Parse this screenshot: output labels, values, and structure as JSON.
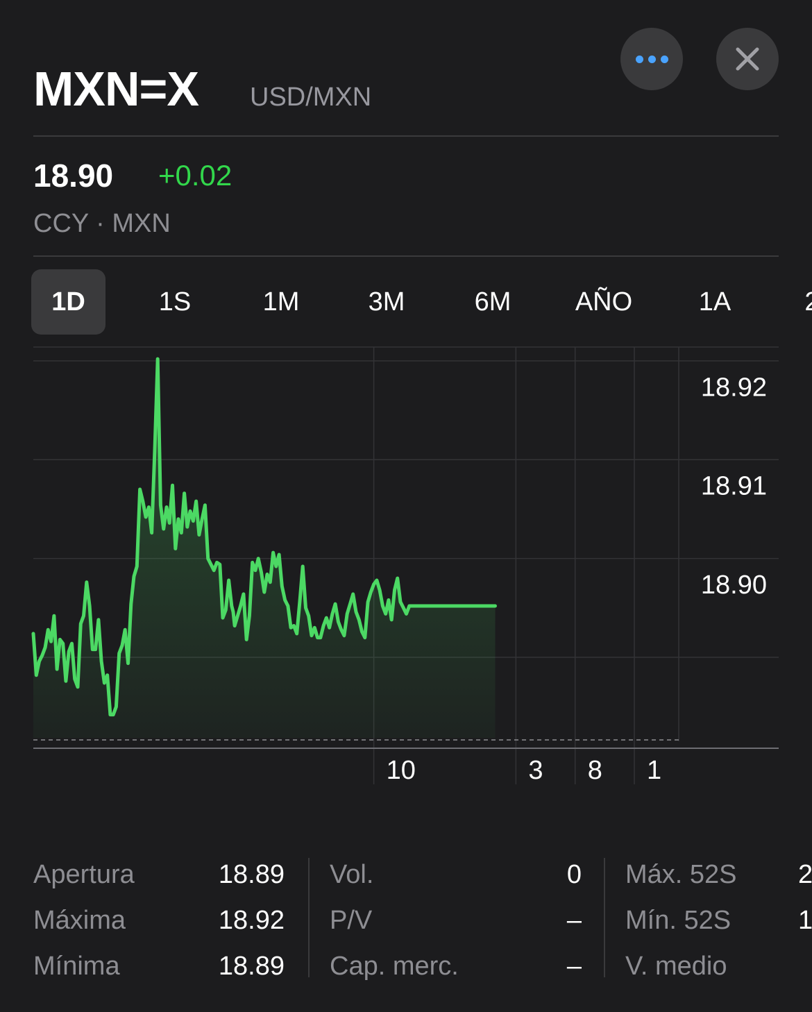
{
  "header": {
    "symbol": "MXN=X",
    "name": "USD/MXN",
    "more_icon": "ellipsis-icon",
    "close_icon": "close-icon"
  },
  "quote": {
    "price": "18.90",
    "change": "+0.02",
    "meta": "CCY · MXN",
    "change_color": "#32d74b"
  },
  "ranges": [
    {
      "label": "1D",
      "active": true
    },
    {
      "label": "1S"
    },
    {
      "label": "1M"
    },
    {
      "label": "3M"
    },
    {
      "label": "6M"
    },
    {
      "label": "AÑO"
    },
    {
      "label": "1A"
    },
    {
      "label": "2"
    }
  ],
  "chart_data": {
    "type": "area",
    "color": "#4cd964",
    "y_tick_labels": [
      "18.92",
      "18.92",
      "18.91",
      "18.90"
    ],
    "y_ticks": [
      18.924,
      18.919,
      18.914,
      18.909
    ],
    "ylim": [
      18.9044,
      18.9247
    ],
    "x_tick_labels": [
      "10",
      "3",
      "8",
      "1"
    ],
    "x_ticks": [
      115,
      163,
      183,
      203
    ],
    "xlim": [
      0,
      218
    ],
    "previous_close": 18.9044,
    "grid": true,
    "x": [
      0,
      1,
      2,
      3,
      4,
      5,
      6,
      7,
      8,
      9,
      10,
      11,
      12,
      13,
      14,
      15,
      16,
      17,
      18,
      19,
      20,
      21,
      22,
      23,
      24,
      25,
      26,
      27,
      28,
      29,
      30,
      31,
      32,
      33,
      34,
      35,
      36,
      37,
      38,
      39,
      40,
      41,
      42,
      43,
      44,
      45,
      46,
      47,
      48,
      49,
      50,
      51,
      52,
      53,
      54,
      55,
      56,
      57,
      58,
      59,
      60,
      61,
      62,
      63,
      64,
      65,
      66,
      67,
      67.5,
      68,
      69,
      70,
      71,
      72,
      73,
      74,
      75,
      76,
      77,
      78,
      79,
      80,
      81,
      82,
      83,
      84,
      85,
      86,
      87,
      88,
      89,
      90,
      91,
      92,
      93,
      94,
      95,
      96,
      97,
      98,
      99,
      100,
      101,
      102,
      103,
      104,
      105,
      106,
      107,
      108,
      109,
      110,
      111,
      112,
      113,
      114,
      115,
      116,
      117,
      118,
      119,
      120,
      121,
      122,
      123,
      124,
      125,
      126,
      127,
      128,
      129,
      130,
      131,
      132,
      133,
      134,
      135,
      136,
      137,
      138,
      139,
      140,
      141,
      142,
      143,
      144,
      145,
      146,
      147,
      148,
      149,
      150,
      151,
      152,
      153,
      154,
      155,
      156
    ],
    "y": [
      18.9102,
      18.9081,
      18.9088,
      18.9091,
      18.9095,
      18.9104,
      18.9098,
      18.9111,
      18.9084,
      18.9099,
      18.9097,
      18.9078,
      18.9093,
      18.9097,
      18.9079,
      18.9075,
      18.9107,
      18.9111,
      18.9128,
      18.9116,
      18.9094,
      18.9094,
      18.9109,
      18.9088,
      18.9077,
      18.9081,
      18.9061,
      18.9061,
      18.9065,
      18.9092,
      18.9096,
      18.9104,
      18.9087,
      18.9117,
      18.9131,
      18.9136,
      18.9175,
      18.9169,
      18.9161,
      18.9166,
      18.9153,
      18.9194,
      18.9241,
      18.9167,
      18.9155,
      18.9166,
      18.9158,
      18.9177,
      18.9145,
      18.916,
      18.9153,
      18.9173,
      18.9156,
      18.9164,
      18.9159,
      18.9169,
      18.9152,
      18.916,
      18.9167,
      18.914,
      18.9137,
      18.9134,
      18.9138,
      18.9137,
      18.911,
      18.9114,
      18.9129,
      18.9116,
      18.9113,
      18.9106,
      18.9111,
      18.9116,
      18.9122,
      18.9099,
      18.9111,
      18.9138,
      18.9134,
      18.914,
      18.9133,
      18.9123,
      18.9132,
      18.9128,
      18.9143,
      18.9136,
      18.9142,
      18.9126,
      18.9119,
      18.9116,
      18.9105,
      18.9106,
      18.9102,
      18.9118,
      18.9136,
      18.9115,
      18.9111,
      18.9101,
      18.9105,
      18.91,
      18.91,
      18.9106,
      18.911,
      18.9105,
      18.9112,
      18.9117,
      18.9108,
      18.9104,
      18.9101,
      18.9112,
      18.9117,
      18.9122,
      18.9113,
      18.9109,
      18.9103,
      18.91,
      18.9118,
      18.9123,
      18.9127,
      18.9129,
      18.9124,
      18.9116,
      18.9112,
      18.9119,
      18.9109,
      18.9124,
      18.913,
      18.9118,
      18.9115,
      18.9112,
      18.9116,
      18.9116,
      18.9116,
      18.9116,
      18.9116,
      18.9116,
      18.9116,
      18.9116,
      18.9116,
      18.9116,
      18.9116,
      18.9116,
      18.9116,
      18.9116,
      18.9116,
      18.9116,
      18.9116,
      18.9116,
      18.9116,
      18.9116,
      18.9116,
      18.9116,
      18.9116,
      18.9116,
      18.9116,
      18.9116,
      18.9116,
      18.9116,
      18.9116,
      18.9116
    ]
  },
  "stats": {
    "col1": [
      {
        "label": "Apertura",
        "value": "18.89"
      },
      {
        "label": "Máxima",
        "value": "18.92"
      },
      {
        "label": "Mínima",
        "value": "18.89"
      }
    ],
    "col2": [
      {
        "label": "Vol.",
        "value": "0"
      },
      {
        "label": "P/V",
        "value": "–"
      },
      {
        "label": "Cap. merc.",
        "value": "–"
      }
    ],
    "col3": [
      {
        "label": "Máx. 52S",
        "value": "2"
      },
      {
        "label": "Mín. 52S",
        "value": "1"
      },
      {
        "label": "V. medio",
        "value": ""
      }
    ]
  }
}
